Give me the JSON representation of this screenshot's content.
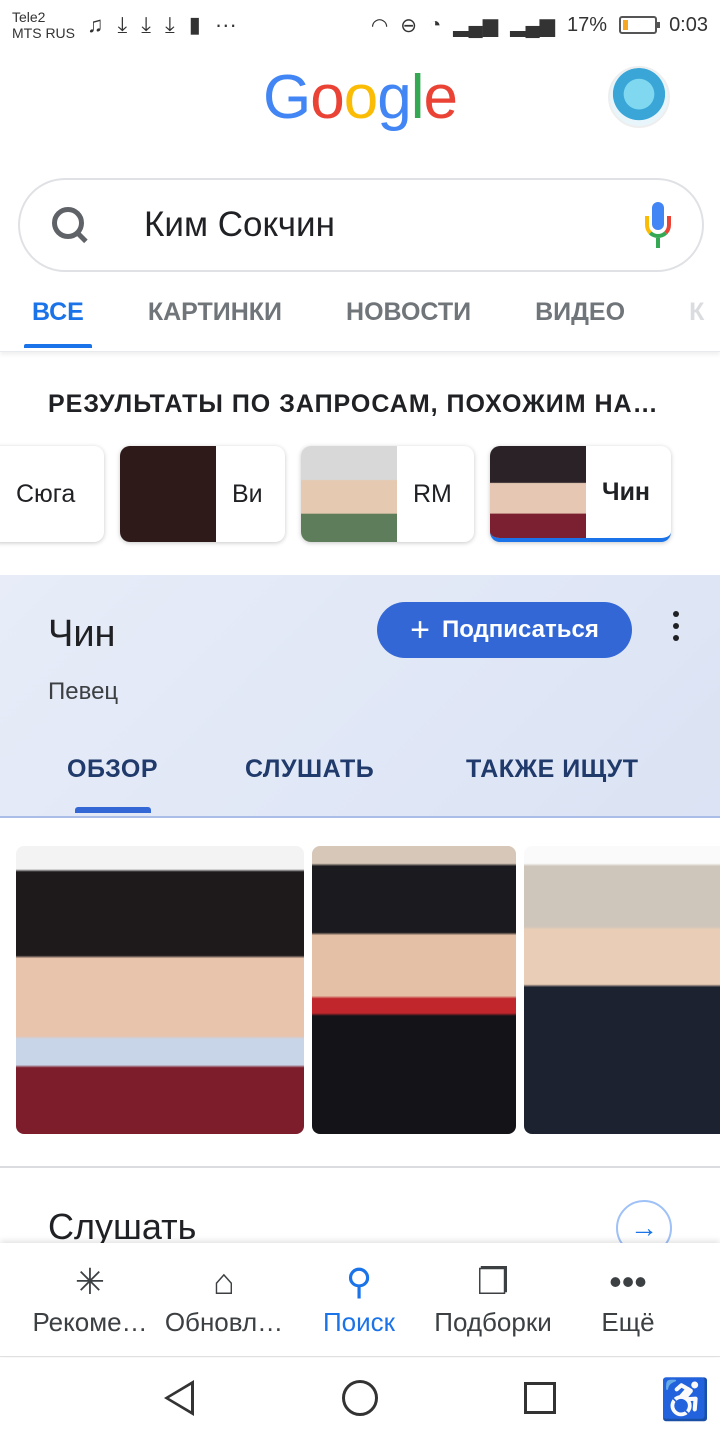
{
  "status_bar": {
    "carrier_line1": "Tele2",
    "carrier_line2": "MTS RUS",
    "more": "···",
    "battery_percent": "17%",
    "battery_level": 0.17,
    "time": "0:03"
  },
  "header": {
    "logo_letters": [
      {
        "char": "G",
        "color": "#4285F4"
      },
      {
        "char": "o",
        "color": "#EA4335"
      },
      {
        "char": "o",
        "color": "#FBBC05"
      },
      {
        "char": "g",
        "color": "#4285F4"
      },
      {
        "char": "l",
        "color": "#34A853"
      },
      {
        "char": "e",
        "color": "#EA4335"
      }
    ]
  },
  "search": {
    "query": "Ким Сокчин"
  },
  "tabs": [
    "ВСЕ",
    "КАРТИНКИ",
    "НОВОСТИ",
    "ВИДЕО",
    "К"
  ],
  "related": {
    "title": "РЕЗУЛЬТАТЫ ПО ЗАПРОСАМ, ПОХОЖИМ НА…",
    "chips": [
      "Сюга",
      "Ви",
      "RM",
      "Чин"
    ]
  },
  "knowledge_panel": {
    "title": "Чин",
    "subtitle": "Певец",
    "subscribe_label": "Подписаться",
    "tabs": [
      "ОБЗОР",
      "СЛУШАТЬ",
      "ТАКЖЕ ИЩУТ"
    ]
  },
  "listen_section": {
    "title": "Слушать"
  },
  "bottom_nav": [
    {
      "label": "Рекоме…",
      "icon": "asterisk-icon"
    },
    {
      "label": "Обновл…",
      "icon": "inbox-updates-icon"
    },
    {
      "label": "Поиск",
      "icon": "search-icon"
    },
    {
      "label": "Подборки",
      "icon": "collections-icon"
    },
    {
      "label": "Ещё",
      "icon": "more-icon"
    }
  ],
  "colors": {
    "accent": "#1A73E8",
    "subscribe_button": "#3367D6",
    "panel_background": "#E3E9F6"
  }
}
